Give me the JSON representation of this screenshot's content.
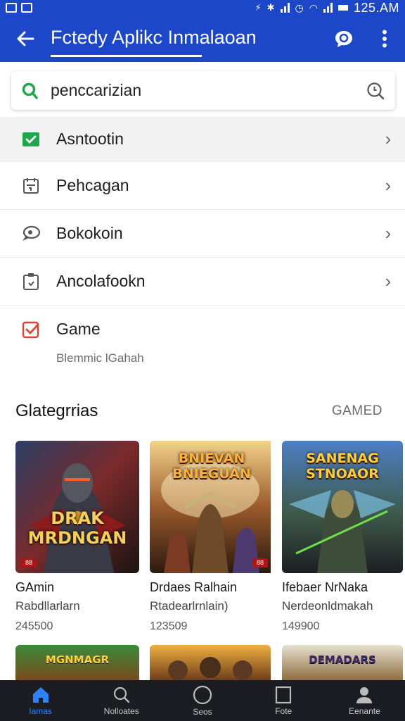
{
  "status_bar": {
    "time": "125.AM"
  },
  "app_bar": {
    "title": "Fctedy Aplikc Inmalaoan"
  },
  "search": {
    "value": "penccarizian"
  },
  "menu": {
    "items": [
      {
        "label": "Asntootin",
        "icon": "calendar-check-icon"
      },
      {
        "label": "Pehcagan",
        "icon": "calendar-icon"
      },
      {
        "label": "Bokokoin",
        "icon": "chat-bubble-icon"
      },
      {
        "label": "Ancolafookn",
        "icon": "clipboard-icon"
      }
    ],
    "game": {
      "label": "Game",
      "subtitle": "Blemmic lGahah",
      "icon": "game-check-icon"
    }
  },
  "categories": {
    "title": "Glategrrias",
    "link": "GAMED",
    "cards": [
      {
        "title": "GAmin",
        "subtitle": "Rabdllarlarn",
        "count": "245500",
        "art_text": "DRAK MRDNGAN",
        "tag": "88"
      },
      {
        "title": "Drdaes Ralhain",
        "subtitle": "Rtadearlrnlain)",
        "count": "123509",
        "art_text": "BNIEVAN BNIEGUAN",
        "tag": "88"
      },
      {
        "title": "Ifebaer NrNaka",
        "subtitle": "Nerdeonldmakah",
        "count": "149900",
        "art_text": "SANENAG STNOAOR",
        "tag": ""
      }
    ],
    "peek": [
      "MGNMAGR",
      "",
      "DEMADARS"
    ]
  },
  "bottom_nav": [
    {
      "label": "Iamas",
      "icon": "home-icon"
    },
    {
      "label": "Nolloates",
      "icon": "search-icon"
    },
    {
      "label": "Seos",
      "icon": "circle-icon"
    },
    {
      "label": "Fote",
      "icon": "square-icon"
    },
    {
      "label": "Eenante",
      "icon": "person-icon"
    }
  ],
  "colors": {
    "app_bar": "#1c47c9",
    "accent_active": "#2f80ff",
    "bottom_nav": "#1b1d22"
  }
}
